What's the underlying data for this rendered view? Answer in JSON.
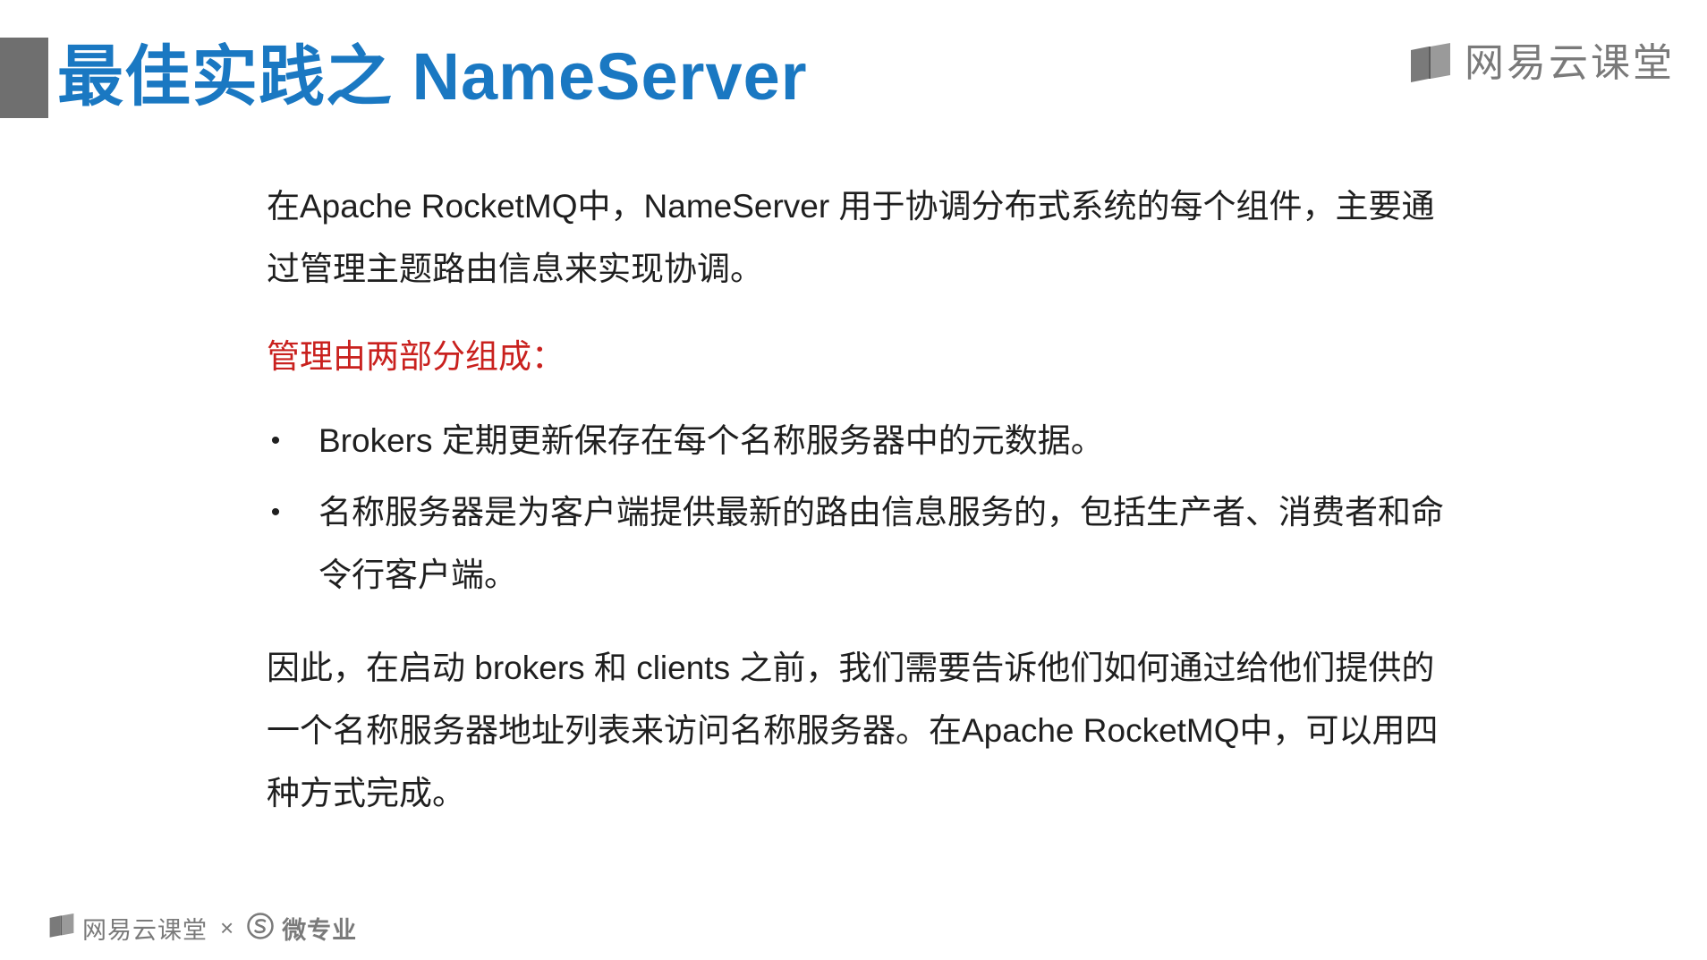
{
  "header": {
    "title": "最佳实践之 NameServer",
    "brand": "网易云课堂"
  },
  "content": {
    "intro": "在Apache RocketMQ中，NameServer 用于协调分布式系统的每个组件，主要通过管理主题路由信息来实现协调。",
    "section_heading": "管理由两部分组成：",
    "bullets": [
      "Brokers 定期更新保存在每个名称服务器中的元数据。",
      "名称服务器是为客户端提供最新的路由信息服务的，包括生产者、消费者和命令行客户端。"
    ],
    "closing": "因此，在启动 brokers 和 clients 之前，我们需要告诉他们如何通过给他们提供的一个名称服务器地址列表来访问名称服务器。在Apache RocketMQ中，可以用四种方式完成。"
  },
  "footer": {
    "brand": "网易云课堂",
    "times": "×",
    "partner": "微专业"
  },
  "colors": {
    "title": "#1a78c2",
    "heading_red": "#c9211e",
    "marker_gray": "#6f6f6f",
    "brand_gray": "#7a7a7a"
  },
  "icons": {
    "brand_logo": "book-icon",
    "partner_logo": "s-circle-icon"
  }
}
